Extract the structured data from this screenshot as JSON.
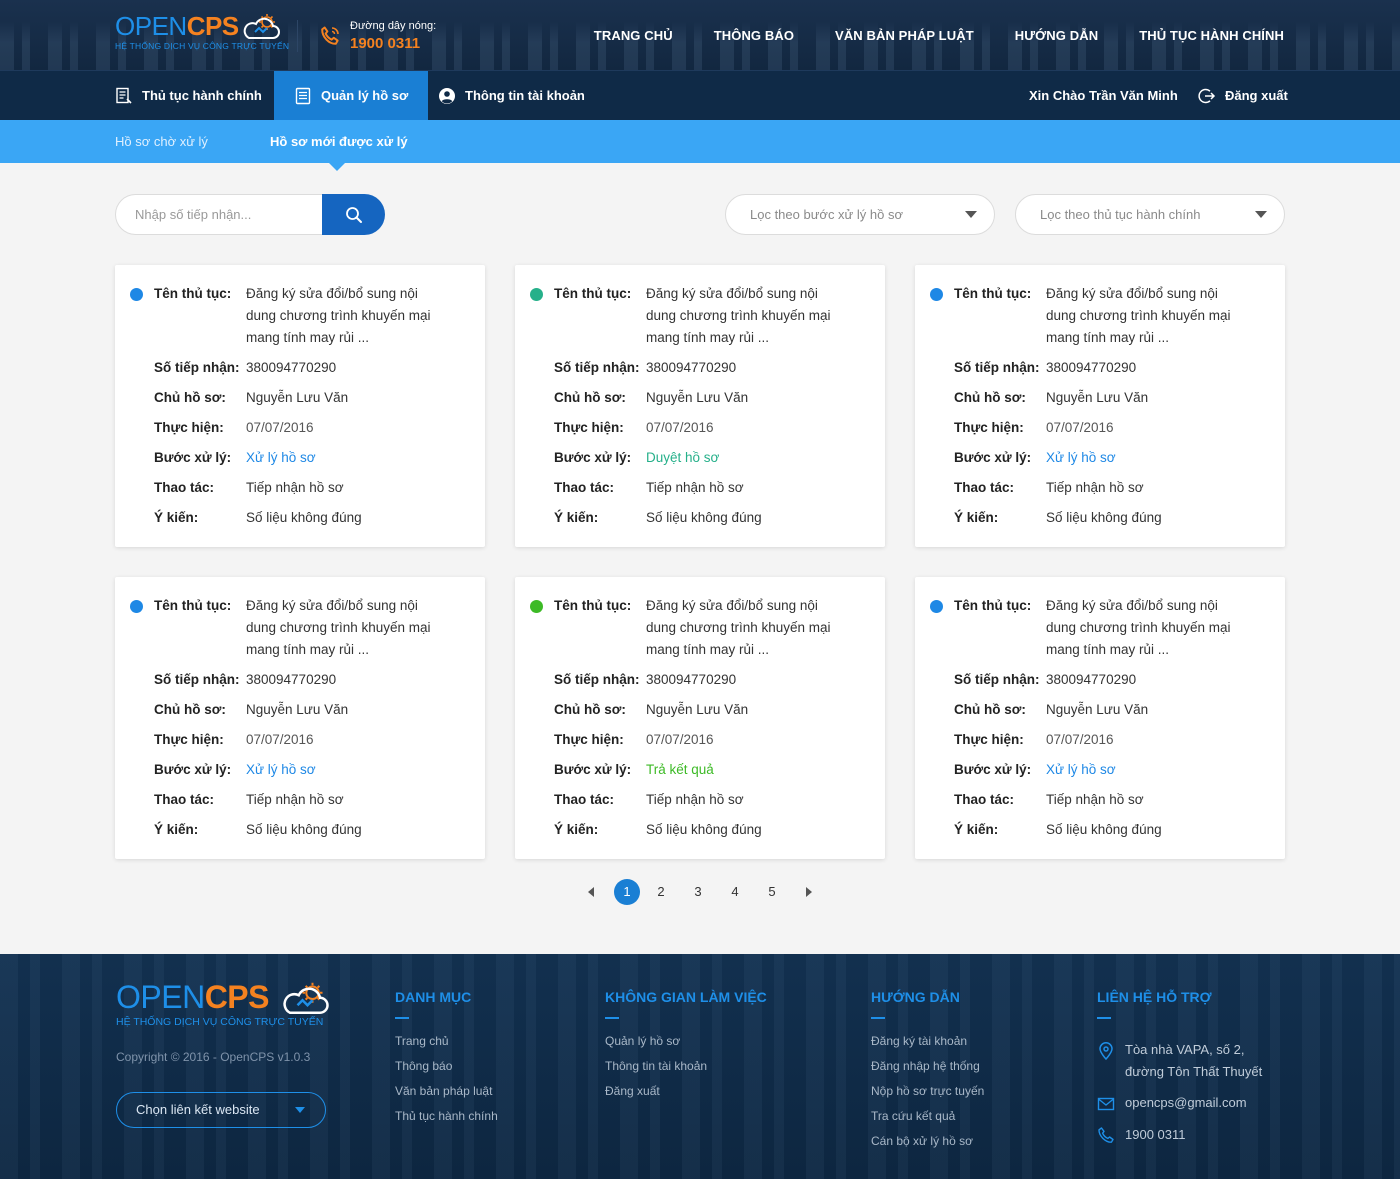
{
  "brand": {
    "logo_open": "OPEN",
    "logo_cps": "CPS",
    "tagline": "HỆ THỐNG DỊCH VỤ CÔNG TRỰC TUYẾN",
    "hotline_label": "Đường dây nóng:",
    "hotline_number": "1900 0311"
  },
  "main_nav": [
    "TRANG CHỦ",
    "THÔNG BÁO",
    "VĂN BẢN PHÁP LUẬT",
    "HƯỚNG DẪN",
    "THỦ TỤC HÀNH CHÍNH"
  ],
  "sub_nav": {
    "items": [
      "Thủ tục hành chính",
      "Quản lý hồ sơ",
      "Thông tin tài khoản"
    ],
    "active_index": 1,
    "greeting": "Xin Chào Trần Văn Minh",
    "logout": "Đăng xuất"
  },
  "tabs": {
    "items": [
      "Hồ sơ chờ xử lý",
      "Hồ sơ mới được xử lý"
    ],
    "active_index": 1
  },
  "search": {
    "placeholder": "Nhập số tiếp nhận..."
  },
  "filters": [
    "Lọc theo bước xử lý hồ sơ",
    "Lọc theo thủ tục hành chính"
  ],
  "card_labels": {
    "procedure": "Tên thủ tục:",
    "receipt": "Số tiếp nhận:",
    "owner": "Chủ hồ sơ:",
    "date": "Thực hiện:",
    "step": "Bước xử lý:",
    "action": "Thao tác:",
    "opinion": "Ý kiến:"
  },
  "cards": [
    {
      "status_color": "#1e88e5",
      "step_color": "#1e88e5",
      "procedure": "Đăng ký sửa đổi/bổ sung nội dung chương trình khuyến mại mang tính may rủi ...",
      "receipt": "380094770290",
      "owner": "Nguyễn Lưu Văn",
      "date": "07/07/2016",
      "step": "Xử lý hồ sơ",
      "action": "Tiếp nhận hồ sơ",
      "opinion": "Số liệu không đúng"
    },
    {
      "status_color": "#26b08a",
      "step_color": "#26b08a",
      "procedure": "Đăng ký sửa đổi/bổ sung nội dung chương trình khuyến mại mang tính may rủi ...",
      "receipt": "380094770290",
      "owner": "Nguyễn Lưu Văn",
      "date": "07/07/2016",
      "step": "Duyệt hồ sơ",
      "action": "Tiếp nhận hồ sơ",
      "opinion": "Số liệu không đúng"
    },
    {
      "status_color": "#1e88e5",
      "step_color": "#1e88e5",
      "procedure": "Đăng ký sửa đổi/bổ sung nội dung chương trình khuyến mại mang tính may rủi ...",
      "receipt": "380094770290",
      "owner": "Nguyễn Lưu Văn",
      "date": "07/07/2016",
      "step": "Xử lý hồ sơ",
      "action": "Tiếp nhận hồ sơ",
      "opinion": "Số liệu không đúng"
    },
    {
      "status_color": "#1e88e5",
      "step_color": "#1e88e5",
      "procedure": "Đăng ký sửa đổi/bổ sung nội dung chương trình khuyến mại mang tính may rủi ...",
      "receipt": "380094770290",
      "owner": "Nguyễn Lưu Văn",
      "date": "07/07/2016",
      "step": "Xử lý hồ sơ",
      "action": "Tiếp nhận hồ sơ",
      "opinion": "Số liệu không đúng"
    },
    {
      "status_color": "#3dba26",
      "step_color": "#3dba26",
      "procedure": "Đăng ký sửa đổi/bổ sung nội dung chương trình khuyến mại mang tính may rủi ...",
      "receipt": "380094770290",
      "owner": "Nguyễn Lưu Văn",
      "date": "07/07/2016",
      "step": "Trả kết quả",
      "action": "Tiếp nhận hồ sơ",
      "opinion": "Số liệu không đúng"
    },
    {
      "status_color": "#1e88e5",
      "step_color": "#1e88e5",
      "procedure": "Đăng ký sửa đổi/bổ sung nội dung chương trình khuyến mại mang tính may rủi ...",
      "receipt": "380094770290",
      "owner": "Nguyễn Lưu Văn",
      "date": "07/07/2016",
      "step": "Xử lý hồ sơ",
      "action": "Tiếp nhận hồ sơ",
      "opinion": "Số liệu không đúng"
    }
  ],
  "pagination": {
    "pages": [
      "1",
      "2",
      "3",
      "4",
      "5"
    ],
    "current": "1"
  },
  "footer": {
    "copyright": "Copyright © 2016 - OpenCPS v1.0.3",
    "link_select": "Chọn liên kết website",
    "columns": [
      {
        "title": "DANH MỤC",
        "items": [
          "Trang chủ",
          "Thông báo",
          "Văn bản pháp luật",
          "Thủ tục hành chính"
        ]
      },
      {
        "title": "KHÔNG GIAN LÀM VIỆC",
        "items": [
          "Quản lý hồ sơ",
          "Thông tin tài khoản",
          "Đăng xuất"
        ]
      },
      {
        "title": "HƯỚNG DẪN",
        "items": [
          "Đăng ký tài khoản",
          "Đăng nhập hệ thống",
          "Nộp hồ sơ trực tuyến",
          "Tra cứu kết quả",
          "Cán bộ xử lý hồ sơ"
        ]
      }
    ],
    "contact": {
      "title": "LIÊN HỆ HỖ TRỢ",
      "address_line1": "Tòa nhà VAPA, số 2,",
      "address_line2": "đường Tôn Thất Thuyết",
      "email": "opencps@gmail.com",
      "phone": "1900 0311"
    }
  },
  "colors": {
    "accent": "#1a7fd4",
    "brand_orange": "#f58220",
    "header_bg": "#0f2a47",
    "tab_bar": "#3aa6f5"
  }
}
